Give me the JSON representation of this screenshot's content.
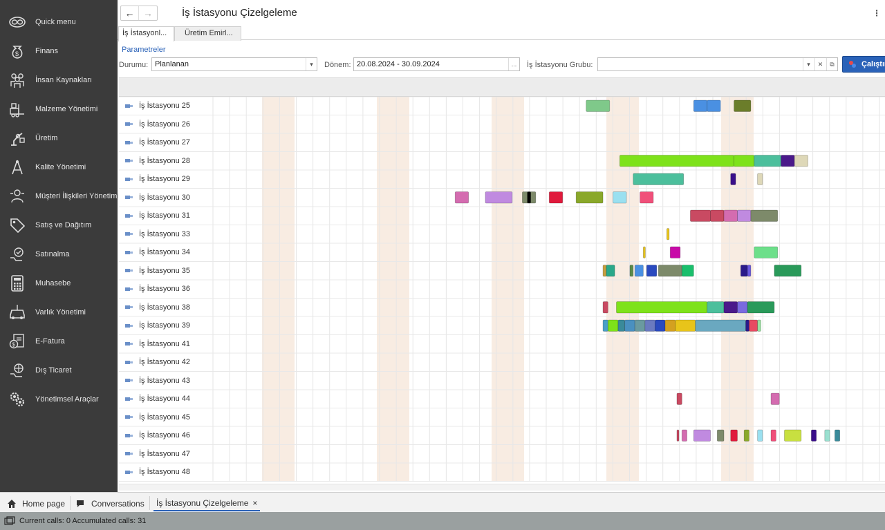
{
  "sidebar": {
    "items": [
      {
        "label": "Quick menu",
        "icon": "quick-menu-icon"
      },
      {
        "label": "Finans",
        "icon": "money-bag-icon"
      },
      {
        "label": "İnsan Kaynakları",
        "icon": "people-icon"
      },
      {
        "label": "Malzeme Yönetimi",
        "icon": "forklift-icon"
      },
      {
        "label": "Üretim",
        "icon": "robot-arm-icon"
      },
      {
        "label": "Kalite Yönetimi",
        "icon": "compass-icon"
      },
      {
        "label": "Müşteri İlişkileri Yönetimi",
        "icon": "customer-icon"
      },
      {
        "label": "Satış ve Dağıtım",
        "icon": "tag-icon"
      },
      {
        "label": "Satınalma",
        "icon": "purchase-icon"
      },
      {
        "label": "Muhasebe",
        "icon": "calculator-icon"
      },
      {
        "label": "Varlık Yönetimi",
        "icon": "car-icon"
      },
      {
        "label": "E-Fatura",
        "icon": "invoice-icon"
      },
      {
        "label": "Dış Ticaret",
        "icon": "globe-hand-icon"
      },
      {
        "label": "Yönetimsel Araçlar",
        "icon": "gears-icon"
      }
    ]
  },
  "header": {
    "title": "İş İstasyonu Çizelgeleme",
    "back": "←",
    "forward": "→",
    "more": "⋮"
  },
  "tabs": [
    "İş İstasyonl...",
    "Üretim Emirl..."
  ],
  "params": {
    "link": "Parametreler",
    "status_label": "Durumu:",
    "status_value": "Planlanan",
    "period_label": "Dönem:",
    "period_value": "20.08.2024 - 30.09.2024",
    "period_btn": "...",
    "group_label": "İş İstasyonu Grubu:",
    "group_value": "",
    "run_label": "Çalıştır"
  },
  "gantt": {
    "rows": [
      "İş İstasyonu 25",
      "İş İstasyonu 26",
      "İş İstasyonu 27",
      "İş İstasyonu 28",
      "İş İstasyonu 29",
      "İş İstasyonu 30",
      "İş İstasyonu 31",
      "İş İstasyonu 33",
      "İş İstasyonu 34",
      "İş İstasyonu 35",
      "İş İstasyonu 36",
      "İş İstasyonu 38",
      "İş İstasyonu 39",
      "İş İstasyonu 41",
      "İş İstasyonu 42",
      "İş İstasyonu 43",
      "İş İstasyonu 44",
      "İş İstasyonu 45",
      "İş İstasyonu 46",
      "İş İstasyonu 47",
      "İş İstasyonu 48"
    ],
    "weekend_color": "#f8ece2",
    "bars": [
      [
        [
          1.6,
          0.7,
          "#7fc98a"
        ],
        [
          4.8,
          0.4,
          "#4a90e2"
        ],
        [
          5.2,
          0.4,
          "#4a90e2"
        ],
        [
          6.0,
          0.5,
          "#6b7d2a"
        ]
      ],
      [],
      [],
      [
        [
          2.6,
          3.4,
          "#7ee21a"
        ],
        [
          6.0,
          0.6,
          "#7ee21a"
        ],
        [
          6.6,
          0.8,
          "#4cbf9c"
        ],
        [
          7.4,
          0.4,
          "#4b1a8a"
        ],
        [
          7.8,
          0.4,
          "#ded8b8"
        ]
      ],
      [
        [
          3.0,
          1.5,
          "#4cbf9c"
        ],
        [
          5.9,
          0.15,
          "#3a0f8a"
        ],
        [
          6.7,
          0.15,
          "#ded8b8"
        ]
      ],
      [
        [
          -2.3,
          0.4,
          "#d46cb0"
        ],
        [
          -1.4,
          0.8,
          "#c08ae0"
        ],
        [
          -0.3,
          0.4,
          "#7d8a6a"
        ],
        [
          0.5,
          0.4,
          "#e01a3c"
        ],
        [
          1.3,
          0.8,
          "#8aa82a"
        ],
        [
          2.4,
          0.4,
          "#9ae0f0"
        ],
        [
          3.2,
          0.4,
          "#f0507a"
        ],
        [
          -0.15,
          0.1,
          "#000000"
        ]
      ],
      [
        [
          4.7,
          0.6,
          "#c94a62"
        ],
        [
          5.3,
          0.4,
          "#c94a62"
        ],
        [
          5.7,
          0.4,
          "#d46cb0"
        ],
        [
          6.1,
          0.4,
          "#c08ae0"
        ],
        [
          6.5,
          0.8,
          "#7d8a6a"
        ]
      ],
      [
        [
          4.0,
          0.07,
          "#e8c41a"
        ]
      ],
      [
        [
          3.3,
          0.05,
          "#e8c41a"
        ],
        [
          4.1,
          0.3,
          "#c80aa8"
        ],
        [
          6.6,
          0.7,
          "#6cdf8a"
        ]
      ],
      [
        [
          2.1,
          0.1,
          "#c8a040"
        ],
        [
          2.2,
          0.25,
          "#2aa88a"
        ],
        [
          2.9,
          0.1,
          "#5a8a4a"
        ],
        [
          3.05,
          0.25,
          "#4a90e2"
        ],
        [
          3.4,
          0.3,
          "#2a4abf"
        ],
        [
          3.75,
          0.7,
          "#7d8a6a"
        ],
        [
          4.45,
          0.35,
          "#1abf6c"
        ],
        [
          6.2,
          0.2,
          "#2a1a8a"
        ],
        [
          6.4,
          0.1,
          "#6a5ae0"
        ],
        [
          7.2,
          0.8,
          "#2a9a5a"
        ]
      ],
      [],
      [
        [
          2.1,
          0.15,
          "#c94a62"
        ],
        [
          2.5,
          2.7,
          "#7ee21a"
        ],
        [
          5.2,
          0.5,
          "#4cbf9c"
        ],
        [
          5.7,
          0.4,
          "#4b1a8a"
        ],
        [
          6.1,
          0.3,
          "#7a6ae0"
        ],
        [
          6.4,
          0.8,
          "#2a9a5a"
        ]
      ],
      [
        [
          2.1,
          0.15,
          "#4aa0c8"
        ],
        [
          2.25,
          0.3,
          "#7ee21a"
        ],
        [
          2.55,
          0.2,
          "#3a8a9a"
        ],
        [
          2.75,
          0.3,
          "#4a90c0"
        ],
        [
          3.05,
          0.3,
          "#6a9aa0"
        ],
        [
          3.35,
          0.3,
          "#6a7ac0"
        ],
        [
          3.65,
          0.3,
          "#2a4abf"
        ],
        [
          3.95,
          0.3,
          "#d4a020"
        ],
        [
          4.25,
          0.6,
          "#e8c41a"
        ],
        [
          4.85,
          1.5,
          "#6aa8c0"
        ],
        [
          6.35,
          0.1,
          "#2a1a8a"
        ],
        [
          6.45,
          0.25,
          "#e84a62"
        ],
        [
          6.7,
          0.1,
          "#9ae0a0"
        ]
      ],
      [],
      [],
      [],
      [
        [
          4.3,
          0.15,
          "#c94a62"
        ],
        [
          7.1,
          0.25,
          "#d46cb0"
        ]
      ],
      [],
      [
        [
          4.3,
          0.05,
          "#c94a62"
        ],
        [
          4.45,
          0.15,
          "#d46cb0"
        ],
        [
          4.8,
          0.5,
          "#c08ae0"
        ],
        [
          5.5,
          0.2,
          "#7d8a6a"
        ],
        [
          5.9,
          0.2,
          "#e01a3c"
        ],
        [
          6.3,
          0.15,
          "#8aa82a"
        ],
        [
          6.7,
          0.15,
          "#9ae0f0"
        ],
        [
          7.1,
          0.15,
          "#f0507a"
        ],
        [
          7.5,
          0.5,
          "#c8e040"
        ],
        [
          8.3,
          0.15,
          "#3a0f8a"
        ],
        [
          8.7,
          0.15,
          "#9ae0d0"
        ],
        [
          9.0,
          0.15,
          "#3a8a9a"
        ]
      ],
      [],
      []
    ]
  },
  "bottom_tabs": {
    "home": "Home page",
    "conversations": "Conversations",
    "active": "İş İstasyonu Çizelgeleme",
    "close": "×"
  },
  "status": {
    "text": "Current calls: 0   Accumulated calls: 31"
  }
}
